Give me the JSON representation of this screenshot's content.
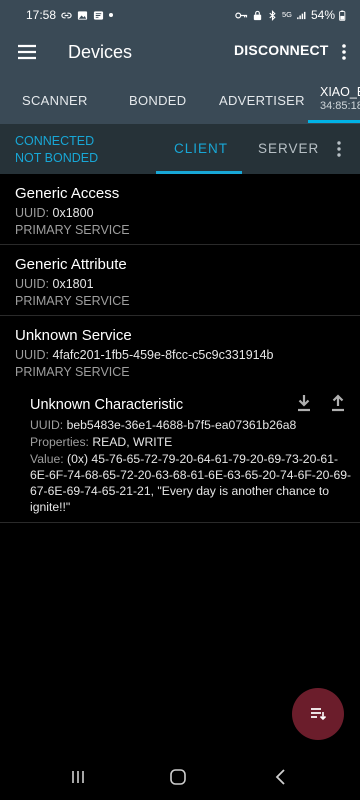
{
  "status_bar": {
    "time": "17:58",
    "network": "5G",
    "battery": "54%"
  },
  "app_bar": {
    "title": "Devices",
    "disconnect_label": "DISCONNECT"
  },
  "tabs": {
    "scanner": "SCANNER",
    "bonded": "BONDED",
    "advertiser": "ADVERTISER",
    "device_name": "XIAO_E",
    "device_address": "34:85:18"
  },
  "connection": {
    "status": "CONNECTED",
    "bond_status": "NOT BONDED",
    "client_tab": "CLIENT",
    "server_tab": "SERVER"
  },
  "services": [
    {
      "name": "Generic Access",
      "uuid_label": "UUID:",
      "uuid": "0x1800",
      "type": "PRIMARY SERVICE"
    },
    {
      "name": "Generic Attribute",
      "uuid_label": "UUID:",
      "uuid": "0x1801",
      "type": "PRIMARY SERVICE"
    },
    {
      "name": "Unknown Service",
      "uuid_label": "UUID:",
      "uuid": "4fafc201-1fb5-459e-8fcc-c5c9c331914b",
      "type": "PRIMARY SERVICE"
    }
  ],
  "characteristic": {
    "name": "Unknown Characteristic",
    "uuid_label": "UUID:",
    "uuid": "beb5483e-36e1-4688-b7f5-ea07361b26a8",
    "properties_label": "Properties:",
    "properties": "READ, WRITE",
    "value_label": "Value:",
    "value": "(0x) 45-76-65-72-79-20-64-61-79-20-69-73-20-61-6E-6F-74-68-65-72-20-63-68-61-6E-63-65-20-74-6F-20-69-67-6E-69-74-65-21-21, \"Every day is another chance to ignite!!\""
  },
  "colors": {
    "app_bar": "#3a4a56",
    "connection_bar": "#263238",
    "accent": "#18a7d6",
    "fab": "#6b1d2b"
  },
  "icons": {
    "menu": "menu-icon",
    "overflow": "more-vert-icon",
    "download": "download-icon",
    "upload": "upload-icon",
    "fab": "log-list-icon"
  }
}
